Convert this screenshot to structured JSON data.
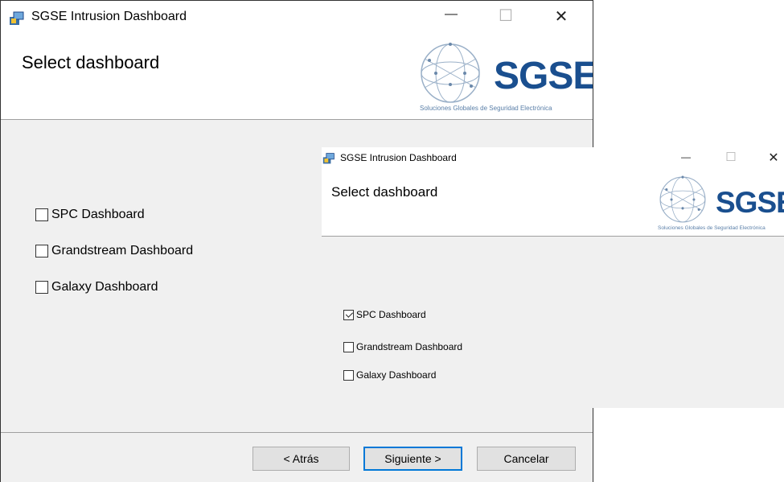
{
  "window_back": {
    "title": "SGSE Intrusion Dashboard",
    "heading": "Select dashboard",
    "logo_text": "SGSE",
    "logo_subtitle": "Soluciones Globales de Seguridad Electrónica",
    "controls": {
      "minimize": "—",
      "maximize": "☐",
      "close": "✕"
    },
    "checkboxes": [
      {
        "label": "SPC Dashboard",
        "checked": false
      },
      {
        "label": "Grandstream Dashboard",
        "checked": false
      },
      {
        "label": "Galaxy Dashboard",
        "checked": false
      }
    ],
    "buttons": {
      "back": "< Atrás",
      "next": "Siguiente >",
      "cancel": "Cancelar"
    }
  },
  "window_front": {
    "title": "SGSE Intrusion Dashboard",
    "heading": "Select dashboard",
    "logo_text": "SGSE",
    "logo_subtitle": "Soluciones Globales de Seguridad Electrónica",
    "controls": {
      "minimize": "—",
      "maximize": "☐",
      "close": "✕"
    },
    "checkboxes": [
      {
        "label": "SPC Dashboard",
        "checked": true
      },
      {
        "label": "Grandstream Dashboard",
        "checked": false
      },
      {
        "label": "Galaxy Dashboard",
        "checked": false
      }
    ]
  }
}
